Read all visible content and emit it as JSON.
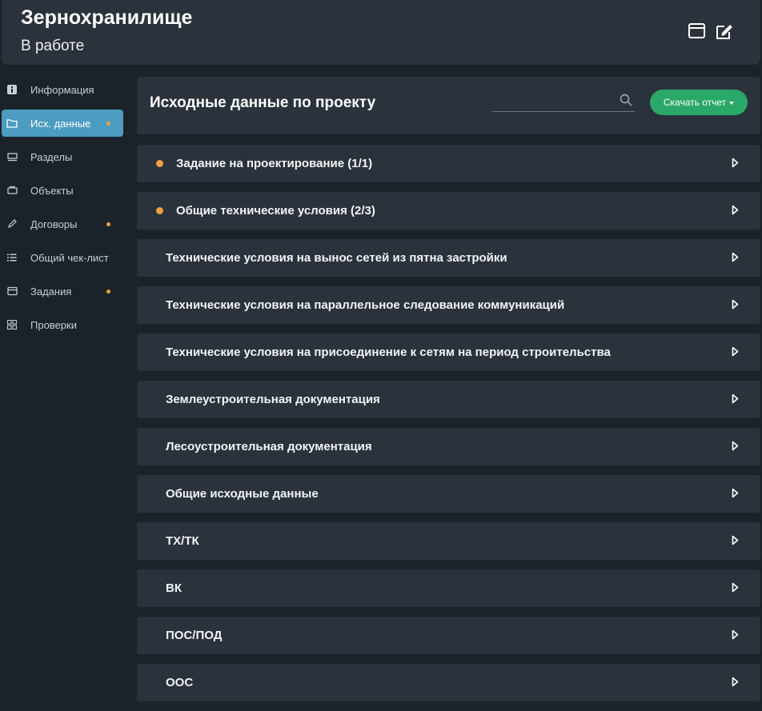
{
  "header": {
    "title": "Зернохранилище",
    "status": "В работе",
    "icons": [
      "window-icon",
      "edit-icon"
    ]
  },
  "sidebar": {
    "items": [
      {
        "label": "Информация",
        "icon": "info-icon",
        "active": false,
        "dot": false
      },
      {
        "label": "Исх. данные",
        "icon": "folder-icon",
        "active": true,
        "dot": true
      },
      {
        "label": "Разделы",
        "icon": "layers-icon",
        "active": false,
        "dot": false
      },
      {
        "label": "Объекты",
        "icon": "box-icon",
        "active": false,
        "dot": false
      },
      {
        "label": "Договоры",
        "icon": "pen-icon",
        "active": false,
        "dot": true
      },
      {
        "label": "Общий чек-лист",
        "icon": "list-icon",
        "active": false,
        "dot": false
      },
      {
        "label": "Задания",
        "icon": "card-icon",
        "active": false,
        "dot": true
      },
      {
        "label": "Проверки",
        "icon": "grid-icon",
        "active": false,
        "dot": false
      }
    ]
  },
  "main": {
    "title": "Исходные данные по проекту",
    "search": {
      "value": "",
      "placeholder": ""
    },
    "report_button": "Скачать отчет",
    "rows": [
      {
        "label": "Задание на проектирование (1/1)",
        "dot": true
      },
      {
        "label": "Общие технические условия (2/3)",
        "dot": true
      },
      {
        "label": "Технические условия на вынос сетей из пятна застройки",
        "dot": false
      },
      {
        "label": "Технические условия на параллельное следование коммуникаций",
        "dot": false
      },
      {
        "label": "Технические условия на присоединение к сетям на период строительства",
        "dot": false
      },
      {
        "label": "Землеустроительная документация",
        "dot": false
      },
      {
        "label": "Лесоустроительная документация",
        "dot": false
      },
      {
        "label": "Общие исходные данные",
        "dot": false
      },
      {
        "label": "ТХ/ТК",
        "dot": false
      },
      {
        "label": "ВК",
        "dot": false
      },
      {
        "label": "ПОС/ПОД",
        "dot": false
      },
      {
        "label": "ООС",
        "dot": false
      }
    ]
  },
  "colors": {
    "accent": "#4b9cc0",
    "button": "#2aa868",
    "dot": "#f0a040",
    "panel": "#2a323b",
    "background": "#1b2229"
  }
}
